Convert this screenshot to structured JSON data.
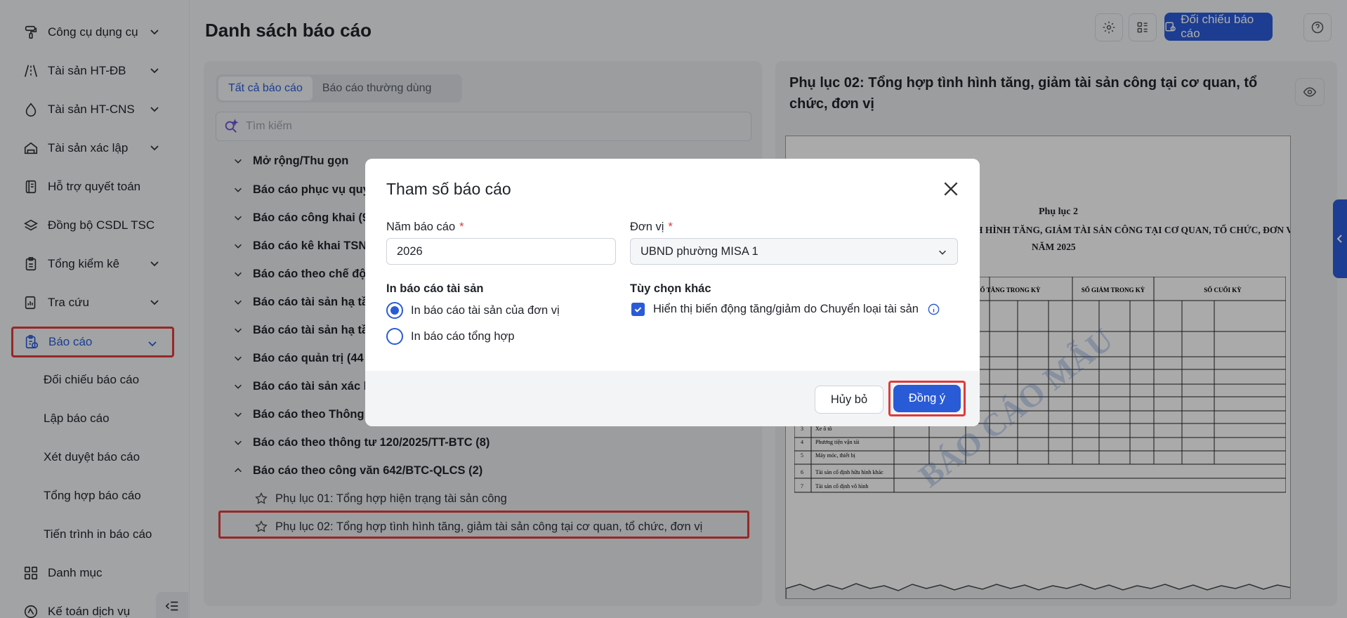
{
  "sidebar": {
    "items": [
      {
        "label": "Công cụ dụng cụ",
        "icon": "brush-icon",
        "chevron": true
      },
      {
        "label": "Tài sản HT-ĐB",
        "icon": "road-icon",
        "chevron": true
      },
      {
        "label": "Tài sản HT-CNS",
        "icon": "water-drop-icon",
        "chevron": true
      },
      {
        "label": "Tài sản xác lập",
        "icon": "house-icon",
        "chevron": true
      },
      {
        "label": "Hỗ trợ quyết toán",
        "icon": "ledger-icon",
        "chevron": false
      },
      {
        "label": "Đồng bộ CSDL TSC",
        "icon": "layers-icon",
        "chevron": false
      },
      {
        "label": "Tổng kiểm kê",
        "icon": "clipboard-icon",
        "chevron": true
      },
      {
        "label": "Tra cứu",
        "icon": "chart-search-icon",
        "chevron": true
      },
      {
        "label": "Báo cáo",
        "icon": "report-icon",
        "chevron": true
      }
    ],
    "sub_items": [
      "Đối chiếu báo cáo",
      "Lập báo cáo",
      "Xét duyệt báo cáo",
      "Tổng hợp báo cáo",
      "Tiến trình in báo cáo"
    ],
    "bottom_items": [
      {
        "label": "Danh mục",
        "icon": "grid-icon"
      },
      {
        "label": "Kế toán dịch vụ",
        "icon": "accounting-icon"
      }
    ]
  },
  "header": {
    "title": "Danh sách báo cáo",
    "compare_button": "Đối chiếu báo cáo"
  },
  "left_panel": {
    "tabs": [
      "Tất cả báo cáo",
      "Báo cáo thường dùng"
    ],
    "search_placeholder": "Tìm kiếm",
    "tree": [
      {
        "label": "Mở rộng/Thu gọn"
      },
      {
        "label": "Báo cáo phục vụ quy"
      },
      {
        "label": "Báo cáo công khai (9"
      },
      {
        "label": "Báo cáo kê khai TSN"
      },
      {
        "label": "Báo cáo theo chế độ"
      },
      {
        "label": "Báo cáo tài sản hạ tầ"
      },
      {
        "label": "Báo cáo tài sản hạ tầ"
      },
      {
        "label": "Báo cáo quản trị (44"
      },
      {
        "label": "Báo cáo tài sản xác l"
      },
      {
        "label": "Báo cáo theo Thông"
      },
      {
        "label": "Báo cáo theo thông tư 120/2025/TT-BTC (8)"
      },
      {
        "label": "Báo cáo theo công văn 642/BTC-QLCS (2)"
      }
    ],
    "leaves": [
      "Phụ lục 01: Tổng hợp hiện trạng tài sản công",
      "Phụ lục 02: Tổng hợp tình hình tăng, giảm tài sản công tại cơ quan, tổ chức, đơn vị"
    ]
  },
  "preview": {
    "title": "Phụ lục 02: Tổng hợp tình hình tăng, giảm tài sản công tại cơ quan, tổ chức, đơn vị",
    "doc_heading": "Phụ lục 2",
    "doc_subtitle": "H HÌNH TĂNG, GIẢM TÀI SẢN CÔNG TẠI CƠ QUAN, TỔ CHỨC, ĐƠN VỊ",
    "doc_year": "NĂM 2025",
    "col_groups": [
      "SỐ TĂNG TRONG KỲ",
      "SỐ GIẢM TRONG KỲ",
      "SỐ CUỐI KỲ"
    ],
    "row_labels": [
      "Xe ô tô",
      "Phương tiện vận tải",
      "Máy móc, thiết bị",
      "Tài sản cố định hữu hình khác",
      "Tài sản cố định vô hình"
    ],
    "watermark": "BÁO CÁO MẪU"
  },
  "dialog": {
    "title": "Tham số báo cáo",
    "year_label": "Năm báo cáo",
    "year_value": "2026",
    "unit_label": "Đơn vị",
    "unit_value": "UBND phường MISA 1",
    "print_section_label": "In báo cáo tài sản",
    "radio_options": [
      "In báo cáo tài sản của đơn vị",
      "In báo cáo tổng hợp"
    ],
    "selected_radio": 0,
    "other_options_label": "Tùy chọn khác",
    "checkbox_label": "Hiển thị biến động tăng/giảm do Chuyển loại tài sản",
    "checkbox_checked": true,
    "cancel_button": "Hủy bỏ",
    "ok_button": "Đồng ý"
  },
  "colors": {
    "primary": "#2a5bd7",
    "highlight_border": "#e03a3a",
    "required": "#e03a3a"
  }
}
